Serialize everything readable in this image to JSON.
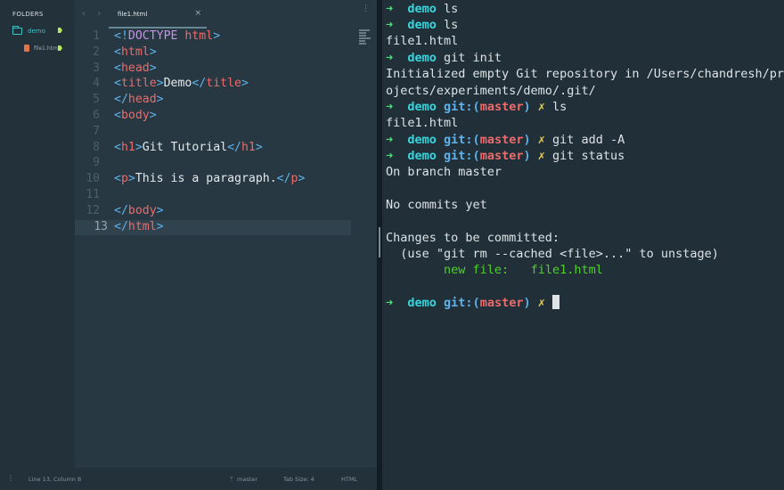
{
  "editor": {
    "sidebar": {
      "title": "FOLDERS",
      "folder": "demo",
      "file": "file1.html"
    },
    "tab": {
      "title": "file1.html",
      "close": "×"
    },
    "menu": "⋮",
    "lines": [
      [
        [
          "br",
          "<!"
        ],
        [
          "dt",
          "DOCTYPE"
        ],
        [
          "tx",
          " "
        ],
        [
          "tg",
          "html"
        ],
        [
          "br",
          ">"
        ]
      ],
      [
        [
          "br",
          "<"
        ],
        [
          "tg",
          "html"
        ],
        [
          "br",
          ">"
        ]
      ],
      [
        [
          "br",
          "<"
        ],
        [
          "tg",
          "head"
        ],
        [
          "br",
          ">"
        ]
      ],
      [
        [
          "br",
          "<"
        ],
        [
          "tg",
          "title"
        ],
        [
          "br",
          ">"
        ],
        [
          "tx",
          "Demo"
        ],
        [
          "br",
          "</"
        ],
        [
          "tg",
          "title"
        ],
        [
          "br",
          ">"
        ]
      ],
      [
        [
          "br",
          "</"
        ],
        [
          "tg",
          "head"
        ],
        [
          "br",
          ">"
        ]
      ],
      [
        [
          "br",
          "<"
        ],
        [
          "tg",
          "body"
        ],
        [
          "br",
          ">"
        ]
      ],
      [],
      [
        [
          "br",
          "<"
        ],
        [
          "tg",
          "h1"
        ],
        [
          "br",
          ">"
        ],
        [
          "tx",
          "Git Tutorial"
        ],
        [
          "br",
          "</"
        ],
        [
          "tg",
          "h1"
        ],
        [
          "br",
          ">"
        ]
      ],
      [],
      [
        [
          "br",
          "<"
        ],
        [
          "tg",
          "p"
        ],
        [
          "br",
          ">"
        ],
        [
          "tx",
          "This is a paragraph."
        ],
        [
          "br",
          "</"
        ],
        [
          "tg",
          "p"
        ],
        [
          "br",
          ">"
        ]
      ],
      [],
      [
        [
          "br",
          "</"
        ],
        [
          "tg",
          "body"
        ],
        [
          "br",
          ">"
        ]
      ],
      [
        [
          "br",
          "</"
        ],
        [
          "tg",
          "html"
        ],
        [
          "br",
          ">"
        ]
      ]
    ],
    "line_numbers": [
      "1",
      "2",
      "3",
      "4",
      "5",
      "6",
      "7",
      "8",
      "9",
      "10",
      "11",
      "12",
      "13"
    ],
    "active_line": 13,
    "status": {
      "position": "Line 13, Column 8",
      "branch": "master",
      "tab_size": "Tab Size: 4",
      "syntax": "HTML"
    }
  },
  "terminal": {
    "lines": [
      [
        [
          "arrow",
          "➜  "
        ],
        [
          "dir",
          "demo"
        ],
        [
          "plain",
          " ls"
        ]
      ],
      [
        [
          "arrow",
          "➜  "
        ],
        [
          "dir",
          "demo"
        ],
        [
          "plain",
          " ls"
        ]
      ],
      [
        [
          "plain",
          "file1.html"
        ]
      ],
      [
        [
          "arrow",
          "➜  "
        ],
        [
          "dir",
          "demo"
        ],
        [
          "plain",
          " git init"
        ]
      ],
      [
        [
          "plain",
          "Initialized empty Git repository in /Users/chandresh/pr"
        ]
      ],
      [
        [
          "plain",
          "ojects/experiments/demo/.git/"
        ]
      ],
      [
        [
          "arrow",
          "➜  "
        ],
        [
          "dir",
          "demo"
        ],
        [
          "plain",
          " "
        ],
        [
          "git",
          "git:("
        ],
        [
          "branch",
          "master"
        ],
        [
          "git",
          ")"
        ],
        [
          "plain",
          " "
        ],
        [
          "dirty",
          "✗"
        ],
        [
          "plain",
          " ls"
        ]
      ],
      [
        [
          "plain",
          "file1.html"
        ]
      ],
      [
        [
          "arrow",
          "➜  "
        ],
        [
          "dir",
          "demo"
        ],
        [
          "plain",
          " "
        ],
        [
          "git",
          "git:("
        ],
        [
          "branch",
          "master"
        ],
        [
          "git",
          ")"
        ],
        [
          "plain",
          " "
        ],
        [
          "dirty",
          "✗"
        ],
        [
          "plain",
          " git add -A"
        ]
      ],
      [
        [
          "arrow",
          "➜  "
        ],
        [
          "dir",
          "demo"
        ],
        [
          "plain",
          " "
        ],
        [
          "git",
          "git:("
        ],
        [
          "branch",
          "master"
        ],
        [
          "git",
          ")"
        ],
        [
          "plain",
          " "
        ],
        [
          "dirty",
          "✗"
        ],
        [
          "plain",
          " git status"
        ]
      ],
      [
        [
          "plain",
          "On branch master"
        ]
      ],
      [],
      [
        [
          "plain",
          "No commits yet"
        ]
      ],
      [],
      [
        [
          "plain",
          "Changes to be committed:"
        ]
      ],
      [
        [
          "plain",
          "  (use \"git rm --cached <file>...\" to unstage)"
        ]
      ],
      [
        [
          "plain",
          "        "
        ],
        [
          "green",
          "new file:   file1.html"
        ]
      ],
      [],
      [
        [
          "arrow",
          "➜  "
        ],
        [
          "dir",
          "demo"
        ],
        [
          "plain",
          " "
        ],
        [
          "git",
          "git:("
        ],
        [
          "branch",
          "master"
        ],
        [
          "git",
          ")"
        ],
        [
          "plain",
          " "
        ],
        [
          "dirty",
          "✗"
        ],
        [
          "plain",
          " "
        ],
        [
          "cursor",
          ""
        ]
      ]
    ]
  },
  "icons": {
    "back": "‹",
    "forward": "›",
    "folder": "folder-icon",
    "file": "html-file-icon",
    "branch": "git-branch-icon"
  }
}
